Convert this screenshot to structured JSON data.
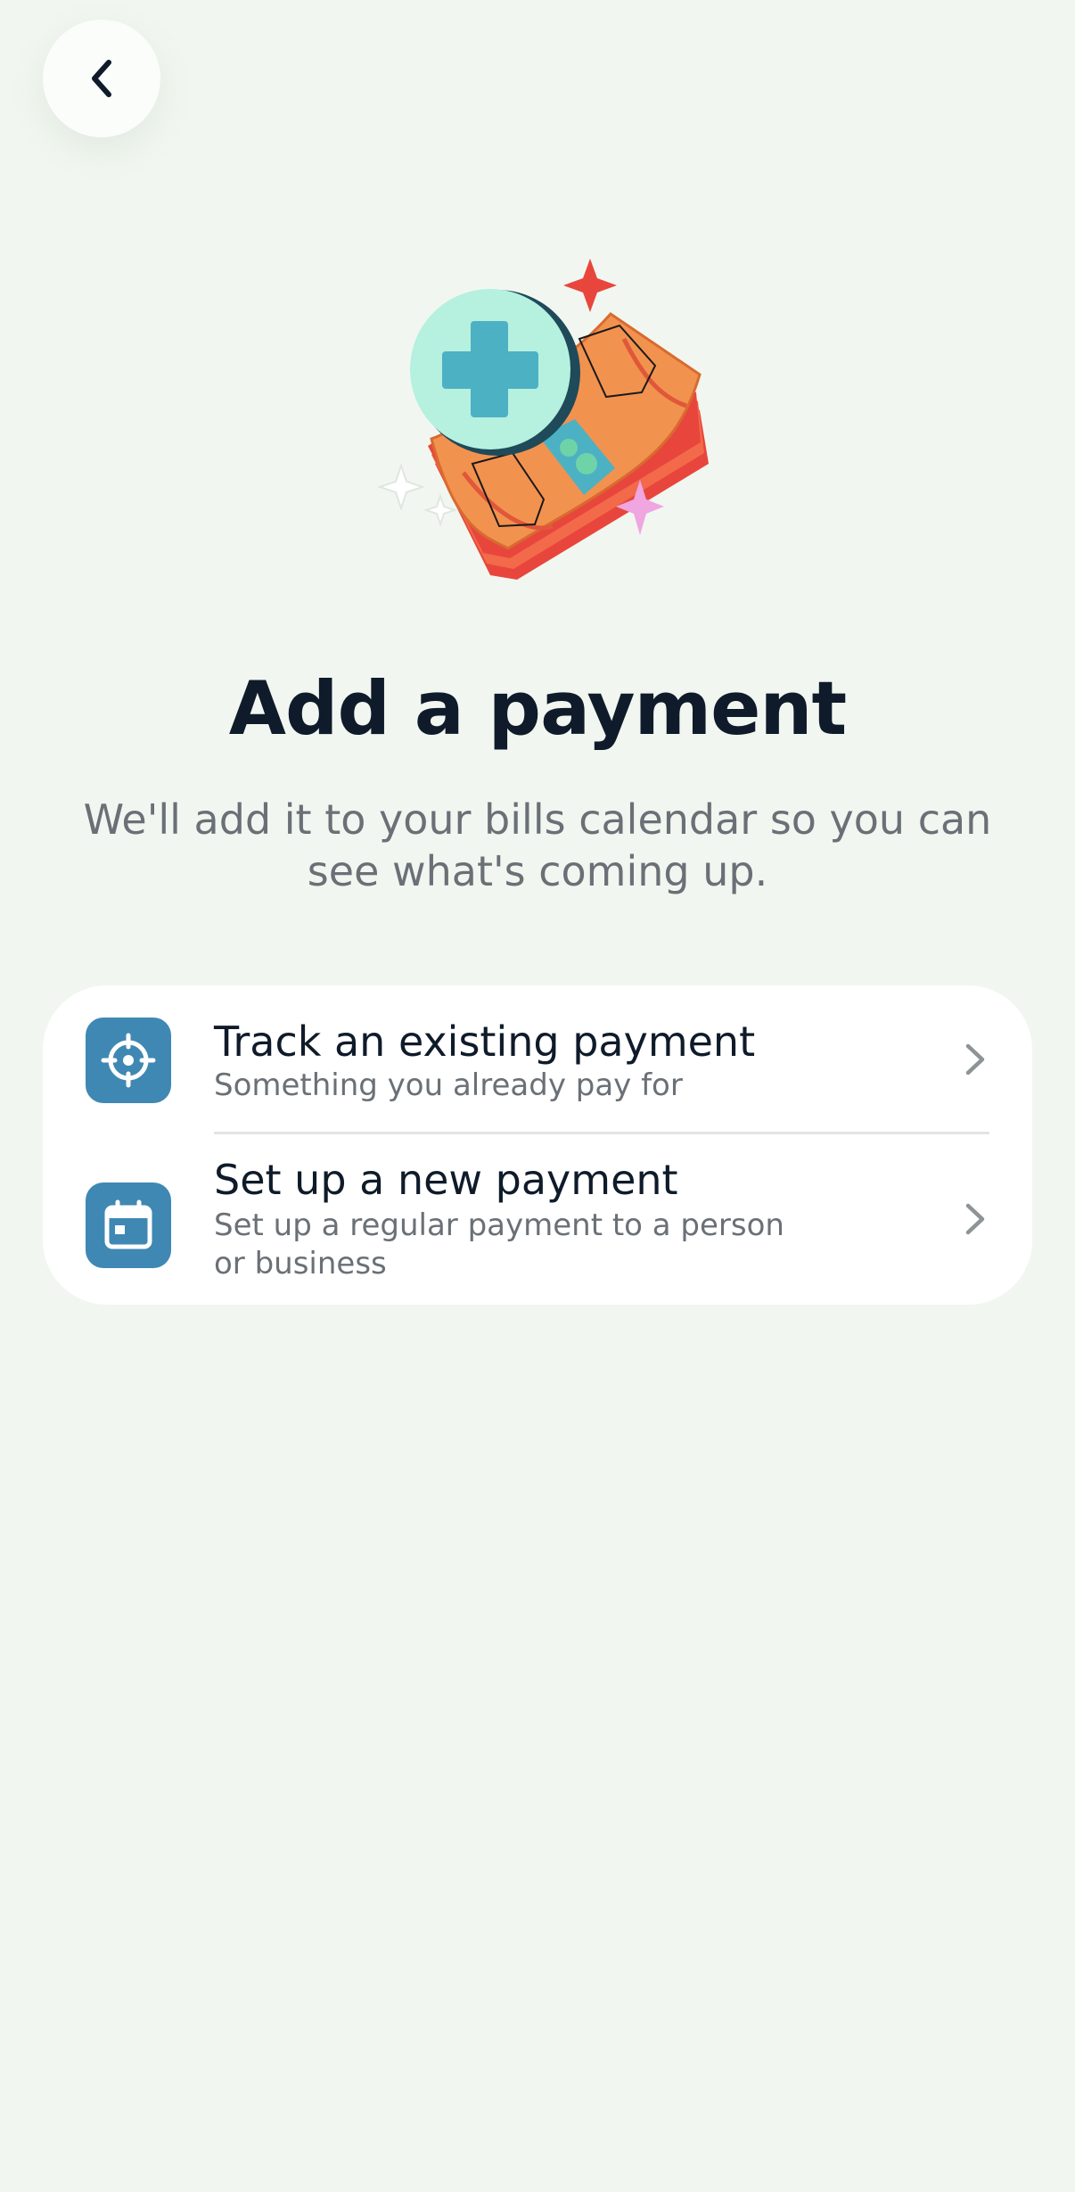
{
  "header": {
    "back_icon": "chevron-left-icon"
  },
  "hero": {
    "illustration": "money-with-plus-illustration",
    "colors": {
      "plus_circle": "#b6f0df",
      "plus_sign": "#4db1c4",
      "cash": "#f2924f",
      "cash_stack": "#e8463c",
      "sparkle_red": "#e8463c",
      "sparkle_pink": "#f0a6e0"
    }
  },
  "main": {
    "title": "Add a payment",
    "subtitle": "We'll add it to your bills calendar so you can see what's coming up."
  },
  "options": [
    {
      "icon": "target-icon",
      "title": "Track an existing payment",
      "description": "Something you already pay for"
    },
    {
      "icon": "calendar-icon",
      "title": "Set up a new payment",
      "description": "Set up a regular payment to a person or business"
    }
  ],
  "colors": {
    "background": "#f1f7f0",
    "card": "#ffffff",
    "icon_tile": "#3f88b3",
    "title_text": "#0f1b2a",
    "secondary_text": "#6a7076"
  }
}
